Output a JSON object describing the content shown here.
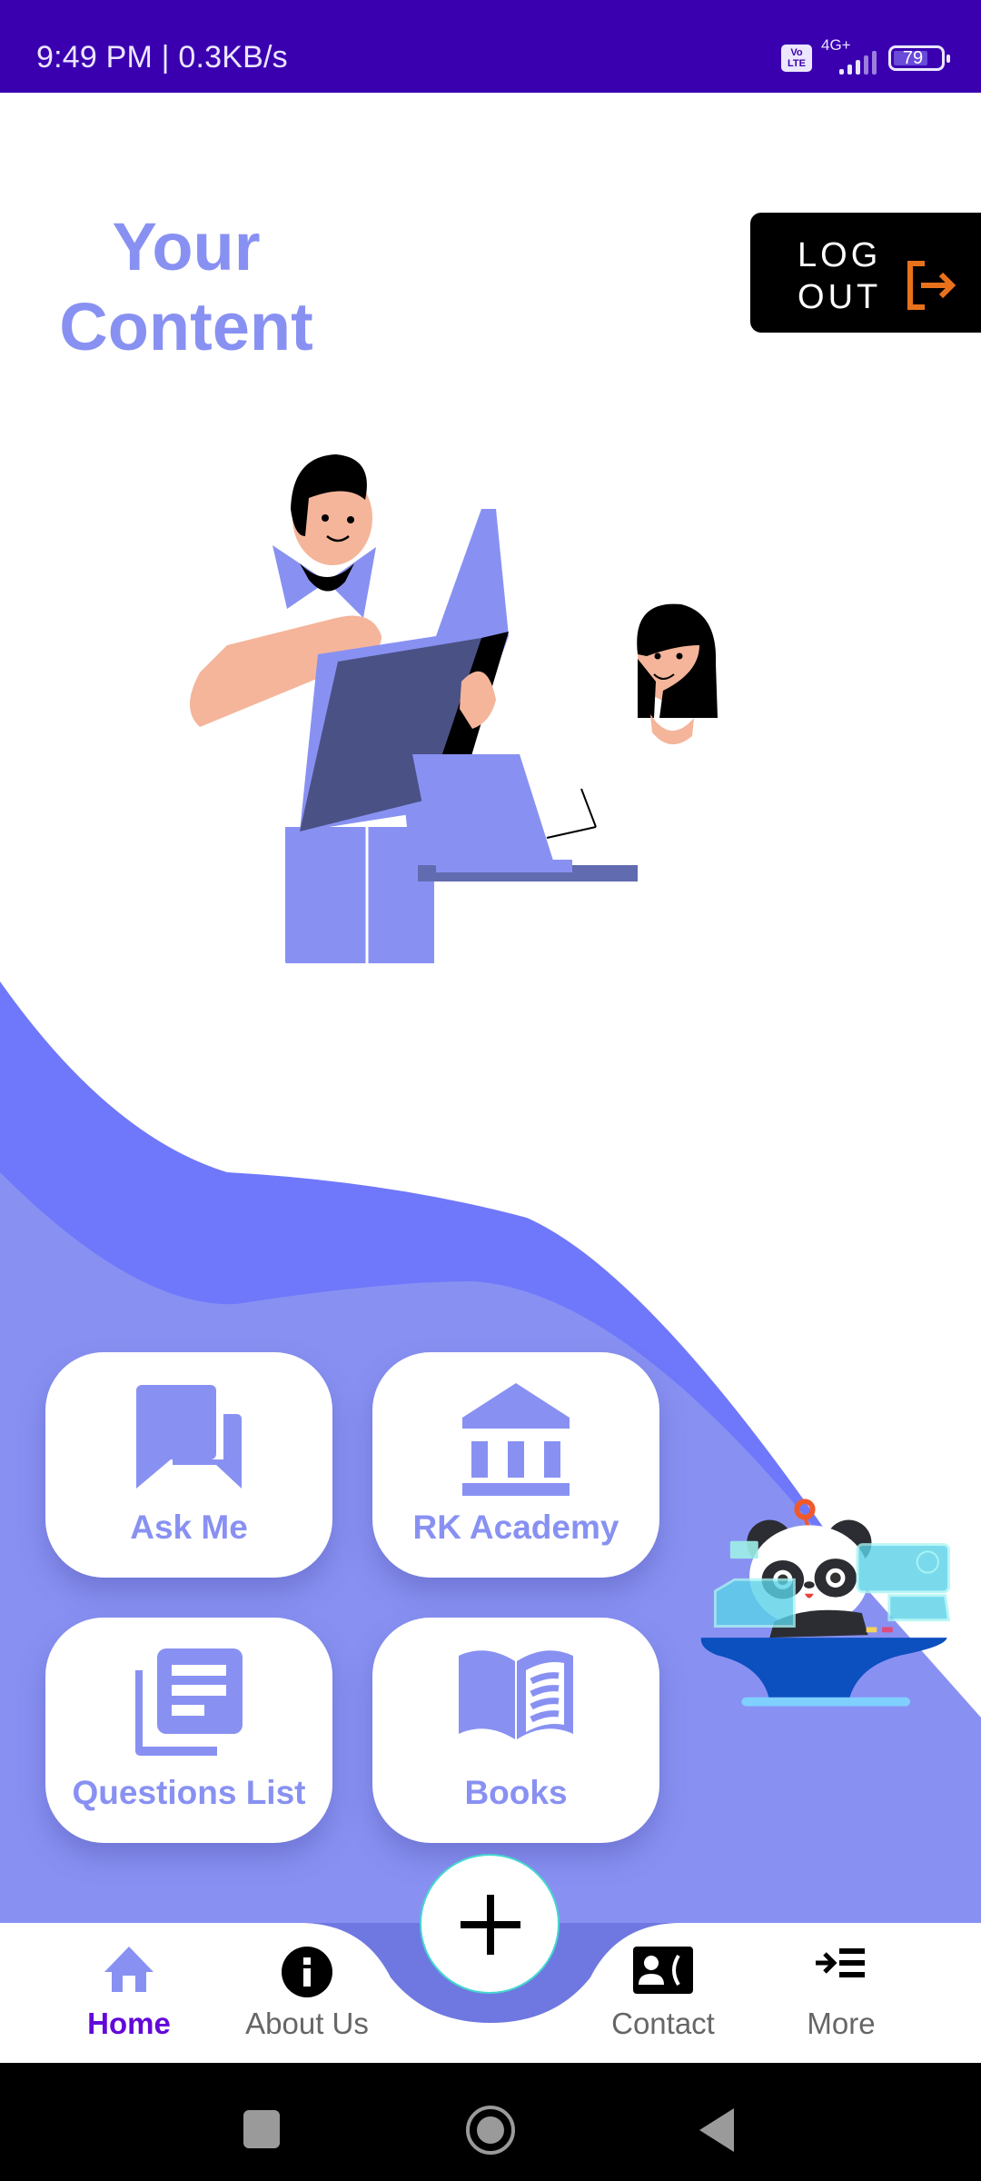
{
  "status_bar": {
    "time": "9:49 PM | 0.3KB/s",
    "volte_line1": "Vo",
    "volte_line2": "LTE",
    "network": "4G+",
    "battery": "79",
    "battery_level_percent": 79
  },
  "header": {
    "title_line1": "Your",
    "title_line2": "Content",
    "logout_line1": "LOG",
    "logout_line2": "OUT",
    "logout_icon": "logout-arrow-icon"
  },
  "illustration": {
    "description": "teacher-with-book-and-student-at-laptop"
  },
  "tiles": [
    {
      "label": "Ask Me",
      "icon": "chat-bubbles-icon"
    },
    {
      "label": "RK Academy",
      "icon": "institution-icon"
    },
    {
      "label": "Questions List",
      "icon": "document-list-icon"
    },
    {
      "label": "Books",
      "icon": "open-book-icon"
    }
  ],
  "bottom_nav": {
    "items": [
      {
        "label": "Home",
        "icon": "home-icon",
        "active": true
      },
      {
        "label": "About Us",
        "icon": "info-icon",
        "active": false
      },
      {
        "label": "Contact",
        "icon": "contact-phone-icon",
        "active": false
      },
      {
        "label": "More",
        "icon": "more-menu-icon",
        "active": false
      }
    ],
    "fab_icon": "plus-icon"
  },
  "colors": {
    "status_bar": "#3a00b0",
    "accent": "#8891f2",
    "accent_dark": "#6f78fa",
    "active_nav": "#6209d8",
    "logout_icon": "#e8721c"
  }
}
